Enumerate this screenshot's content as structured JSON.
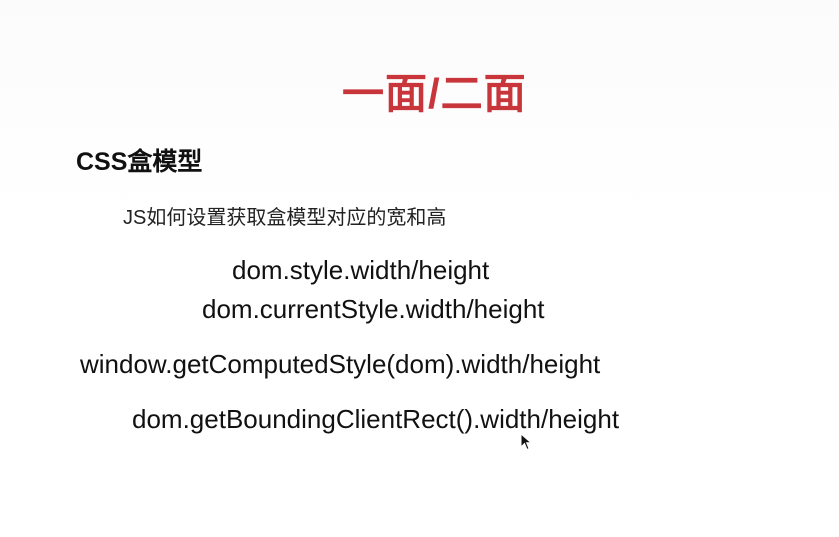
{
  "slide": {
    "title": "一面/二面",
    "section_heading": "CSS盒模型",
    "question": "JS如何设置获取盒模型对应的宽和高",
    "code_lines": [
      "dom.style.width/height",
      "dom.currentStyle.width/height",
      "window.getComputedStyle(dom).width/height",
      "dom.getBoundingClientRect().width/height"
    ]
  },
  "colors": {
    "title": "#c8363c",
    "text": "#111111"
  },
  "icons": {
    "cursor": "mouse-pointer-icon"
  }
}
